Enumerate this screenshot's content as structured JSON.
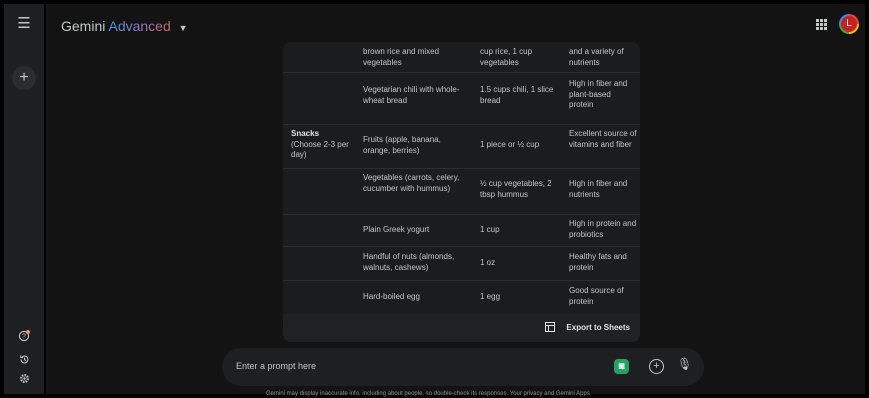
{
  "header": {
    "brand": "Gemini",
    "tier": "Advanced",
    "avatar_initial": "L"
  },
  "colors": {
    "accent_gradient": [
      "#4796e3",
      "#9177c7",
      "#ca6673"
    ],
    "avatar_bg": "#c5221f",
    "notification_dot": "#f28b82"
  },
  "table": {
    "rows": [
      {
        "category": "",
        "category_note": "",
        "food": "brown rice and mixed vegetables",
        "serving": "cup rice, 1 cup vegetables",
        "benefit": "and a variety of nutrients"
      },
      {
        "category": "",
        "category_note": "",
        "food": "Vegetarian chili with whole-wheat bread",
        "serving": "1.5 cups chili, 1 slice bread",
        "benefit": "High in fiber and plant-based protein"
      },
      {
        "category": "Snacks",
        "category_note": "(Choose 2-3 per day)",
        "food": "Fruits (apple, banana, orange, berries)",
        "serving": "1 piece or ½ cup",
        "benefit": "Excellent source of vitamins and fiber"
      },
      {
        "category": "",
        "category_note": "",
        "food": "Vegetables (carrots, celery, cucumber with hummus)",
        "serving": "½ cup vegetables, 2 tbsp hummus",
        "benefit": "High in fiber and nutrients"
      },
      {
        "category": "",
        "category_note": "",
        "food": "Plain Greek yogurt",
        "serving": "1 cup",
        "benefit": "High in protein and probiotics"
      },
      {
        "category": "",
        "category_note": "",
        "food": "Handful of nuts (almonds, walnuts, cashews)",
        "serving": "1 oz",
        "benefit": "Healthy fats and protein"
      },
      {
        "category": "",
        "category_note": "",
        "food": "Hard-boiled egg",
        "serving": "1 egg",
        "benefit": "Good source of protein"
      }
    ],
    "export_label": "Export to Sheets"
  },
  "prompt": {
    "placeholder": "Enter a prompt here"
  },
  "disclaimer": "Gemini may display inaccurate info, including about people, so double-check its responses. Your privacy and Gemini Apps",
  "icons": {
    "menu": "menu-icon",
    "new_chat": "plus-icon",
    "help": "help-icon",
    "activity": "history-icon",
    "settings": "gear-icon",
    "apps": "apps-grid-icon",
    "sheets": "table-icon",
    "gallery": "image-icon",
    "add": "add-circle-icon",
    "mic": "mic-icon"
  }
}
